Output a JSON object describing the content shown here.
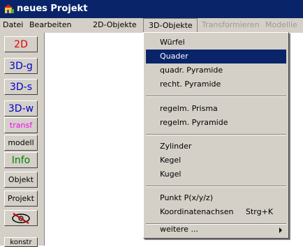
{
  "window": {
    "title": "neues Projekt"
  },
  "menubar": {
    "items": [
      {
        "label": "Datei"
      },
      {
        "label": "Bearbeiten"
      },
      {
        "label": "2D-Objekte"
      },
      {
        "label": "3D-Objekte",
        "state": "open"
      },
      {
        "label": "Transformieren",
        "state": "disabled"
      },
      {
        "label": "Modellie",
        "state": "disabled"
      }
    ]
  },
  "toolbar": {
    "items": [
      {
        "label": "2D",
        "color": "#e00000"
      },
      {
        "label": "3D-g",
        "color": "#0000cc"
      },
      {
        "label": "3D-s",
        "color": "#0000cc"
      },
      {
        "label": "3D-w",
        "color": "#0000cc"
      },
      {
        "label": "transf",
        "color": "#ff00ff"
      },
      {
        "label": "modell",
        "color": "#000000"
      },
      {
        "label": "Info",
        "color": "#008000"
      },
      {
        "label": "Objekt",
        "color": "#000000"
      },
      {
        "label": "Projekt",
        "color": "#000000"
      },
      {
        "icon": "eye-target-icon"
      },
      {
        "label": "konstr",
        "color": "#000000"
      }
    ]
  },
  "dropdown_3d": {
    "items": [
      {
        "label": "Würfel"
      },
      {
        "label": "Quader",
        "selected": true
      },
      {
        "label": "quadr. Pyramide"
      },
      {
        "label": "recht. Pyramide"
      },
      {
        "label": "regelm. Prisma"
      },
      {
        "label": "regelm. Pyramide"
      },
      {
        "label": "Zylinder"
      },
      {
        "label": "Kegel"
      },
      {
        "label": "Kugel"
      },
      {
        "label": "Punkt P(x/y/z)"
      },
      {
        "label": "Koordinatenachsen",
        "shortcut": "Strg+K"
      },
      {
        "label": "weitere ...",
        "submenu": true
      }
    ]
  },
  "colors": {
    "selection": "#0a246a",
    "face": "#d4d0c8",
    "title": "#0a246a"
  }
}
